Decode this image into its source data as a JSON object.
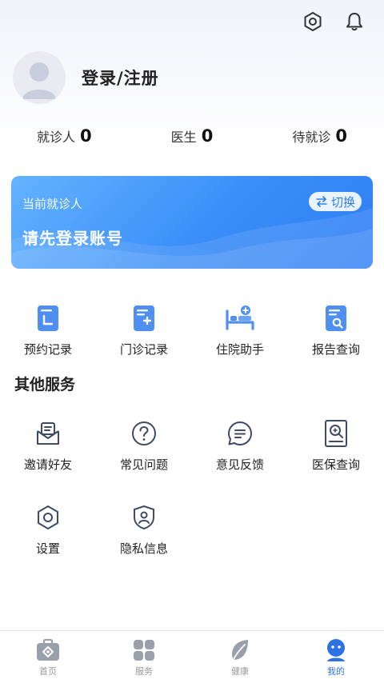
{
  "header": {
    "icons": [
      "settings-icon",
      "bell-icon"
    ]
  },
  "profile": {
    "login_label": "登录/注册"
  },
  "stats": [
    {
      "label": "就诊人",
      "value": "0"
    },
    {
      "label": "医生",
      "value": "0"
    },
    {
      "label": "待就诊",
      "value": "0"
    }
  ],
  "patient_card": {
    "title": "当前就诊人",
    "message": "请先登录账号",
    "switch_label": "切换",
    "accent_color": "#3b8ef8"
  },
  "quick_actions": [
    {
      "label": "预约记录",
      "icon": "appointment-record-icon"
    },
    {
      "label": "门诊记录",
      "icon": "outpatient-record-icon"
    },
    {
      "label": "住院助手",
      "icon": "hospital-bed-icon"
    },
    {
      "label": "报告查询",
      "icon": "report-search-icon"
    }
  ],
  "other_services": {
    "title": "其他服务",
    "items": [
      {
        "label": "邀请好友",
        "icon": "invite-mail-icon"
      },
      {
        "label": "常见问题",
        "icon": "question-icon"
      },
      {
        "label": "意见反馈",
        "icon": "feedback-icon"
      },
      {
        "label": "医保查询",
        "icon": "insurance-search-icon"
      },
      {
        "label": "设置",
        "icon": "settings-icon"
      },
      {
        "label": "隐私信息",
        "icon": "privacy-shield-icon"
      }
    ]
  },
  "tabbar": {
    "tabs": [
      {
        "label": "首页",
        "icon": "home-medkit-icon"
      },
      {
        "label": "服务",
        "icon": "services-grid-icon"
      },
      {
        "label": "健康",
        "icon": "leaf-icon"
      },
      {
        "label": "我的",
        "icon": "user-face-icon"
      }
    ],
    "active_index": 3,
    "active_color": "#2d72e5"
  }
}
